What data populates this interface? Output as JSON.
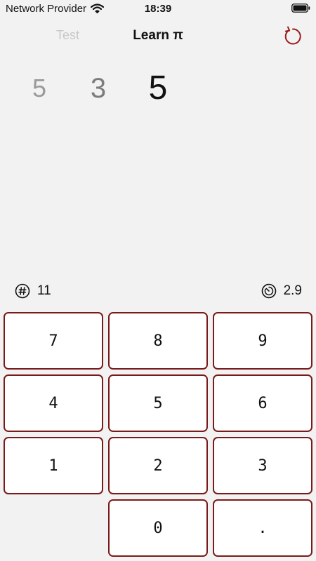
{
  "status_bar": {
    "carrier": "Network Provider",
    "time": "18:39"
  },
  "nav": {
    "left_tab": "Test",
    "title": "Learn π",
    "reset_icon": "counterclockwise-arrow-icon",
    "accent_color": "#9b1c1c"
  },
  "display": {
    "digits": [
      "5",
      "3",
      "5"
    ]
  },
  "stats": {
    "count_icon": "number-sign-circle-icon",
    "count": "11",
    "timer_icon": "timer-icon",
    "time": "2.9"
  },
  "keypad": {
    "border_color": "#7a1b1b",
    "keys": [
      "7",
      "8",
      "9",
      "4",
      "5",
      "6",
      "1",
      "2",
      "3",
      "0",
      "."
    ]
  }
}
